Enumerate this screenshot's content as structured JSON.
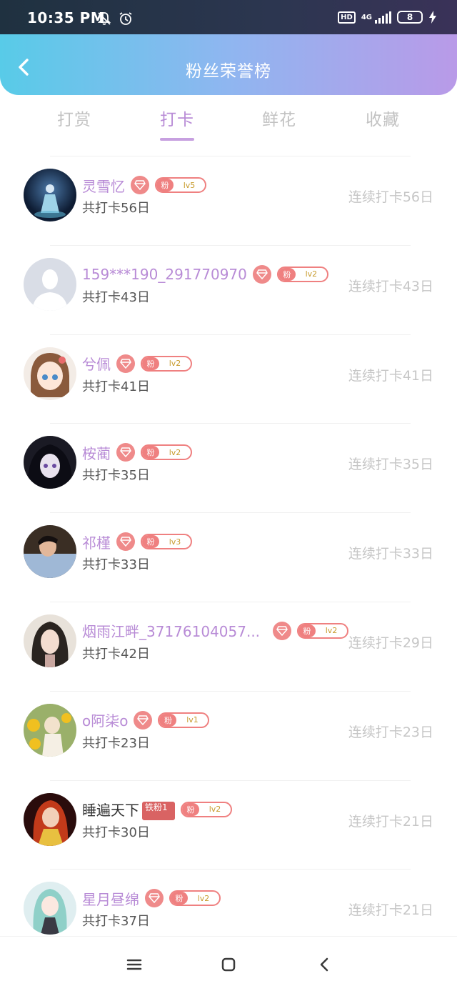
{
  "status": {
    "time": "10:35 PM",
    "network": "4G",
    "hd": "HD",
    "battery": "8"
  },
  "header": {
    "title": "粉丝荣誉榜"
  },
  "tabs": [
    {
      "label": "打赏"
    },
    {
      "label": "打卡"
    },
    {
      "label": "鲜花"
    },
    {
      "label": "收藏"
    }
  ],
  "fans": [
    {
      "name": "灵雪忆",
      "level": "lv5",
      "fan_tag": "粉",
      "total": "共打卡56日",
      "streak": "连续打卡56日"
    },
    {
      "name": "159***190_291770970",
      "level": "lv2",
      "fan_tag": "粉",
      "total": "共打卡43日",
      "streak": "连续打卡43日"
    },
    {
      "name": "兮佩",
      "level": "lv2",
      "fan_tag": "粉",
      "total": "共打卡41日",
      "streak": "连续打卡41日"
    },
    {
      "name": "桉蔺",
      "level": "lv2",
      "fan_tag": "粉",
      "total": "共打卡35日",
      "streak": "连续打卡35日"
    },
    {
      "name": "祁槿",
      "level": "lv3",
      "fan_tag": "粉",
      "total": "共打卡33日",
      "streak": "连续打卡33日"
    },
    {
      "name": "烟雨江畔_37176104057...",
      "level": "lv2",
      "fan_tag": "粉",
      "total": "共打卡42日",
      "streak": "连续打卡29日"
    },
    {
      "name": "o阿柒o",
      "level": "lv1",
      "fan_tag": "粉",
      "total": "共打卡23日",
      "streak": "连续打卡23日"
    },
    {
      "name": "睡遍天下",
      "badge": "铁粉1",
      "level": "lv2",
      "fan_tag": "粉",
      "total": "共打卡30日",
      "streak": "连续打卡21日"
    },
    {
      "name": "星月昼绵",
      "level": "lv2",
      "fan_tag": "粉",
      "total": "共打卡37日",
      "streak": "连续打卡21日"
    }
  ],
  "colors": {
    "accent": "#b88bd6",
    "fan_badge": "#ef8080",
    "muted": "#c6c6c6"
  }
}
